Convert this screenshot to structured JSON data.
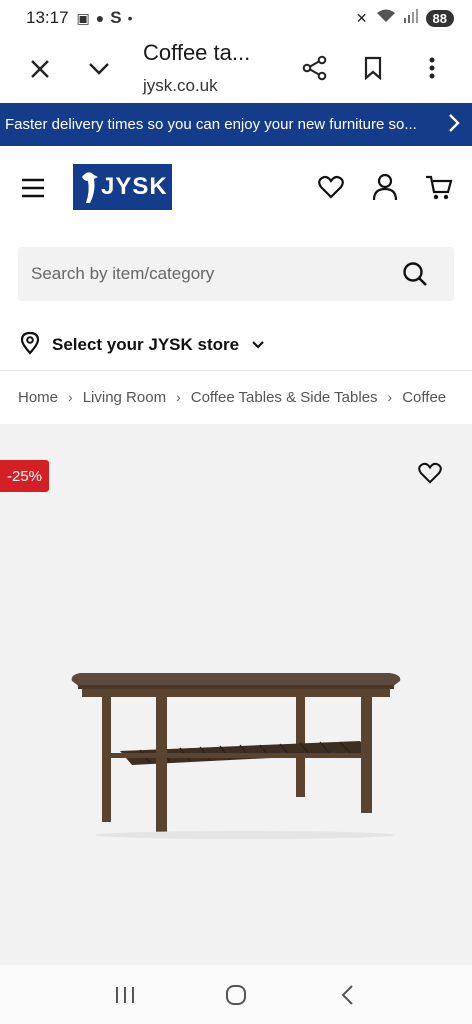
{
  "status_bar": {
    "time": "13:17",
    "battery": "88"
  },
  "browser": {
    "title": "Coffee ta...",
    "url": "jysk.co.uk"
  },
  "promo": {
    "text": "Faster delivery times so you can enjoy your new furniture so..."
  },
  "header": {
    "logo_text": "JYSK"
  },
  "search": {
    "placeholder": "Search by item/category"
  },
  "store": {
    "label": "Select your JYSK store"
  },
  "breadcrumb": {
    "items": [
      "Home",
      "Living Room",
      "Coffee Tables & Side Tables",
      "Coffee"
    ]
  },
  "product": {
    "discount_badge": "-25%"
  },
  "colors": {
    "brand_blue": "#143c8a",
    "discount_red": "#d41f25",
    "product_bg": "#f2f2f2"
  },
  "icons": [
    "close-icon",
    "chevron-down-icon",
    "share-icon",
    "bookmark-icon",
    "more-icon",
    "hamburger-icon",
    "heart-icon",
    "user-icon",
    "cart-icon",
    "search-icon",
    "location-pin-icon"
  ]
}
